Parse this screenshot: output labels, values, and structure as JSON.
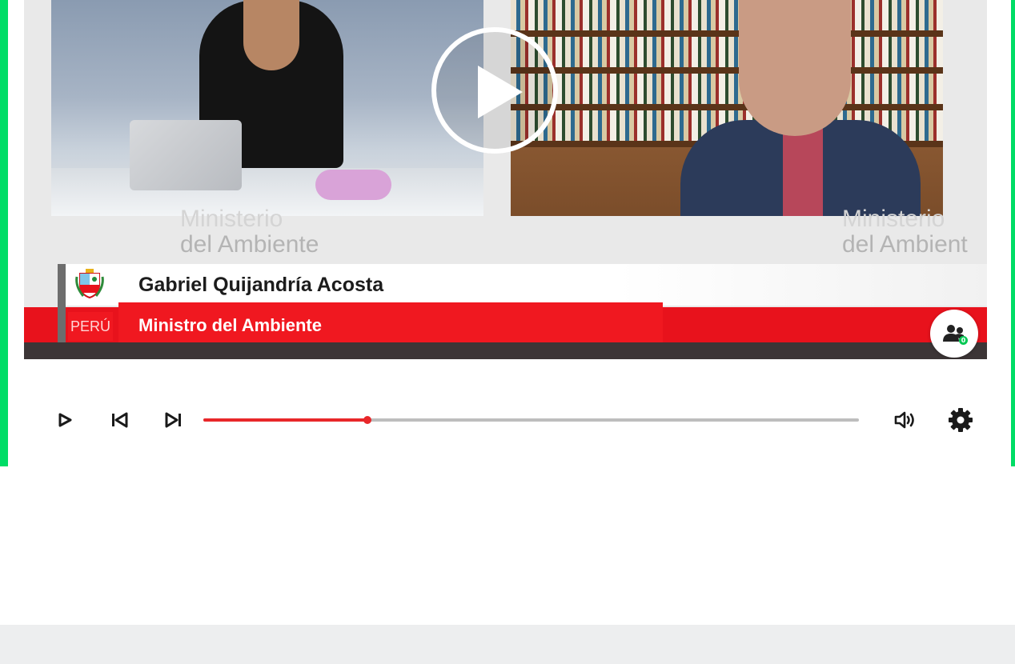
{
  "video": {
    "watermark_left": [
      "Ministerio",
      "del Ambiente"
    ],
    "watermark_right": [
      "Ministerio",
      "del Ambient"
    ],
    "lower_third": {
      "name": "Gabriel Quijandría Acosta",
      "title": "Ministro del Ambiente",
      "country": "PERÚ"
    },
    "viewer_count": "0"
  },
  "controls": {
    "progress": 0.25,
    "icons": [
      "play-icon",
      "skip-previous-icon",
      "skip-next-icon",
      "volume-icon",
      "settings-gear-icon"
    ]
  },
  "colors": {
    "page_green": "#00dd66",
    "progress_red": "#e8272a",
    "track_grey": "#bdbdbd",
    "banner_red": "#e8121c"
  }
}
